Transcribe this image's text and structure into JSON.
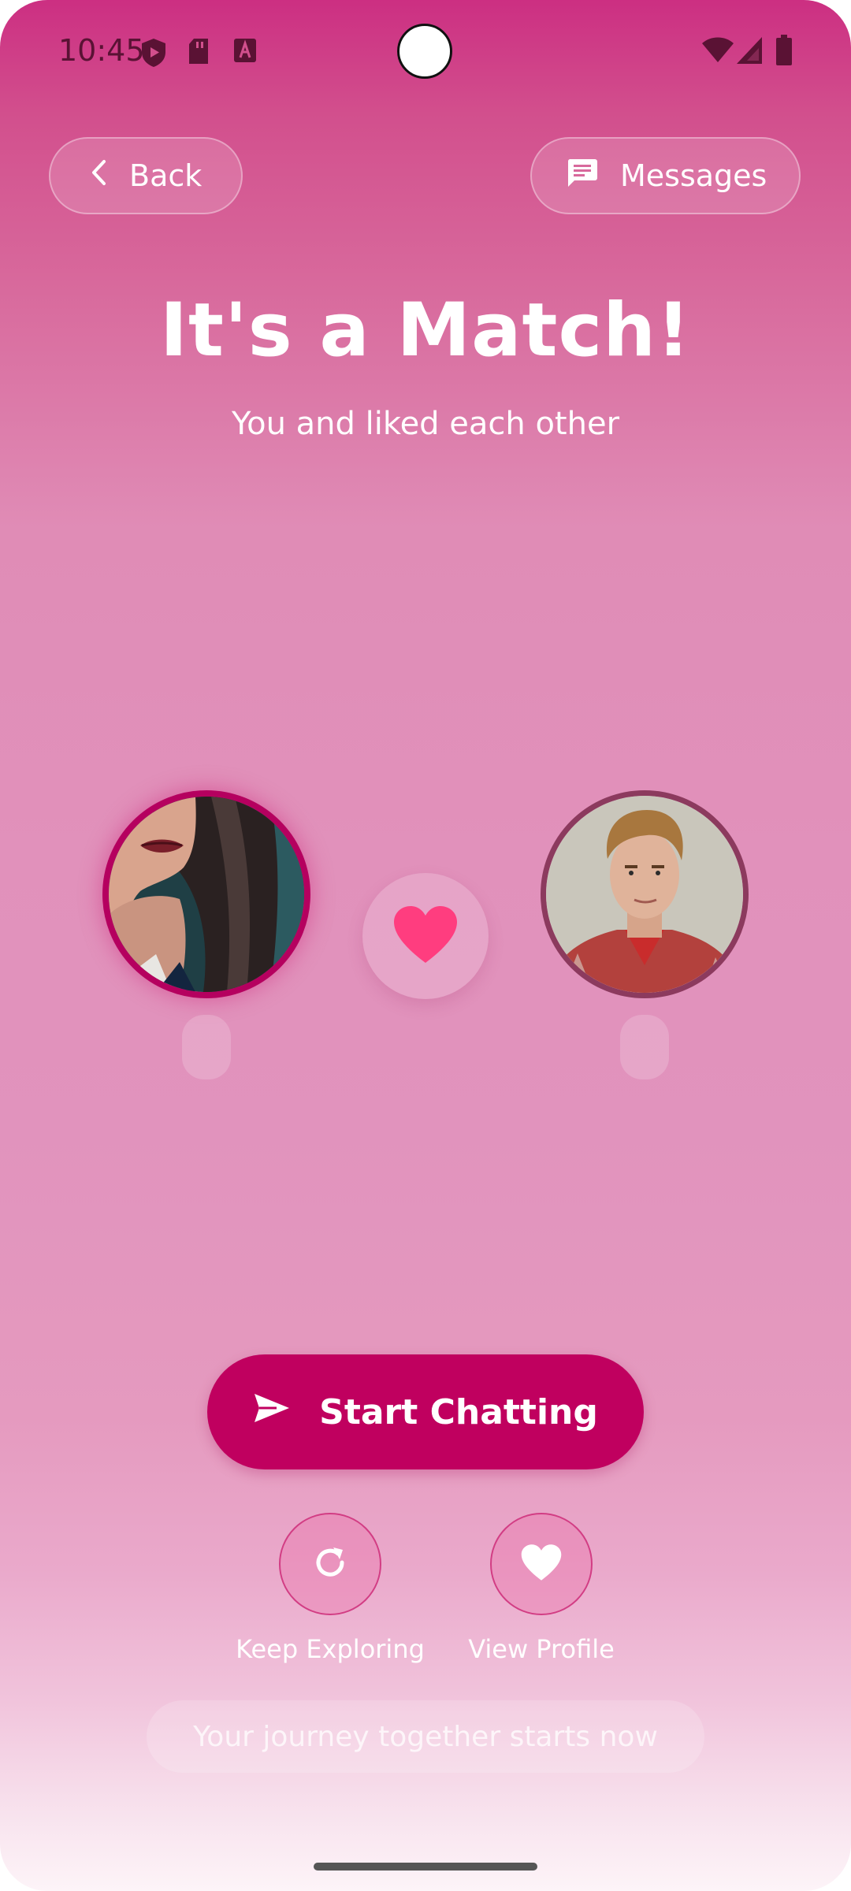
{
  "status_bar": {
    "time": "10:45",
    "left_icons": [
      "shield-icon",
      "sd-card-icon",
      "keyboard-a-icon"
    ],
    "right_icons": [
      "wifi-icon",
      "signal-icon",
      "battery-icon"
    ]
  },
  "header": {
    "back_label": "Back",
    "messages_label": "Messages"
  },
  "match": {
    "title": "It's a Match!",
    "subtitle": "You and  liked each other"
  },
  "profiles": {
    "left_avatar": "woman-portrait",
    "right_avatar": "man-portrait",
    "center_icon": "heart-icon",
    "heart_color": "#ff3d7f"
  },
  "actions": {
    "start_chatting_label": "Start Chatting",
    "keep_exploring_label": "Keep Exploring",
    "view_profile_label": "View Profile"
  },
  "footer": {
    "tagline": "Your journey together starts now"
  },
  "colors": {
    "accent": "#c0005f",
    "background_top": "#cc2f82",
    "background_bottom": "#fdf4f8"
  }
}
